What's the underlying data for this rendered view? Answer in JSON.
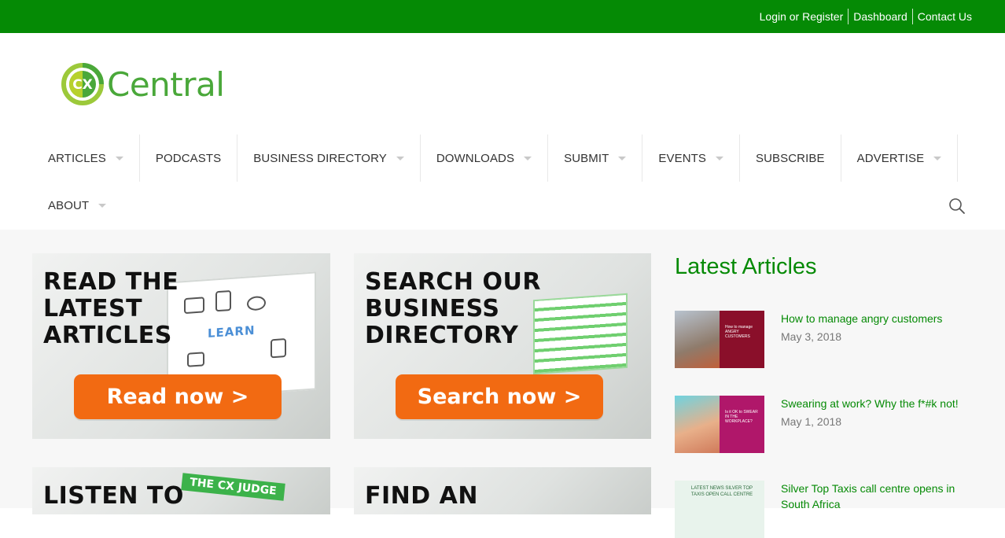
{
  "topbar": {
    "links": [
      "Login or Register",
      "Dashboard",
      "Contact Us"
    ],
    "bg_color": "#058a05"
  },
  "logo": {
    "mark_text": "CX",
    "text": "Central"
  },
  "nav": {
    "items": [
      {
        "label": "ARTICLES",
        "dropdown": true
      },
      {
        "label": "PODCASTS",
        "dropdown": false
      },
      {
        "label": "BUSINESS DIRECTORY",
        "dropdown": true
      },
      {
        "label": "DOWNLOADS",
        "dropdown": true
      },
      {
        "label": "SUBMIT",
        "dropdown": true
      },
      {
        "label": "EVENTS",
        "dropdown": true
      },
      {
        "label": "SUBSCRIBE",
        "dropdown": false
      },
      {
        "label": "ADVERTISE",
        "dropdown": true
      },
      {
        "label": "ABOUT",
        "dropdown": true
      }
    ],
    "search_icon": "search-icon"
  },
  "banners": {
    "articles": {
      "heading": "READ THE\nLATEST\nARTICLES",
      "cta": "Read now >",
      "overlay_word": "LEARN"
    },
    "directory": {
      "heading": "SEARCH OUR\nBUSINESS\nDIRECTORY",
      "cta": "Search now >"
    },
    "podcasts": {
      "heading": "LISTEN TO",
      "badge": "THE CX JUDGE"
    },
    "find": {
      "heading": "FIND AN"
    }
  },
  "sidebar": {
    "title": "Latest Articles",
    "articles": [
      {
        "title": "How to manage angry customers",
        "date": "May 3, 2018",
        "thumb_text": "How to manage ANGRY CUSTOMERS",
        "thumb_color": "#8a0f2a"
      },
      {
        "title": "Swearing at work? Why the f*#k not!",
        "date": "May 1, 2018",
        "thumb_text": "Is it OK to SWEAR IN THE WORKPLACE?",
        "thumb_color": "#b0176a"
      },
      {
        "title": "Silver Top Taxis call centre opens in South Africa",
        "date": "",
        "thumb_text": "LATEST NEWS SILVER TOP TAXIS OPEN CALL CENTRE",
        "thumb_color": "#e8f3ec"
      }
    ]
  },
  "colors": {
    "accent": "#058a05",
    "cta": "#f26a12",
    "logo_green": "#4aa83a"
  }
}
